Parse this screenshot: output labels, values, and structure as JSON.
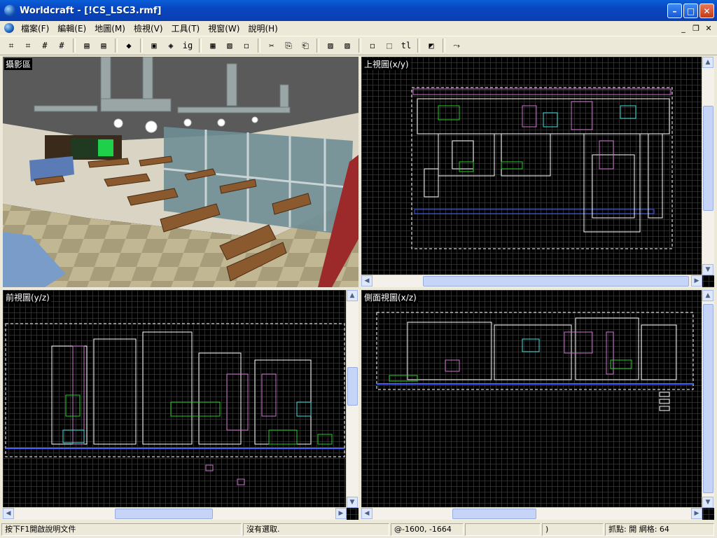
{
  "window": {
    "title": "Worldcraft - [!CS_LSC3.rmf]",
    "minimize": "–",
    "maximize": "□",
    "close": "✕"
  },
  "menu": {
    "items": [
      "檔案(F)",
      "編輯(E)",
      "地圖(M)",
      "檢視(V)",
      "工具(T)",
      "視窗(W)",
      "說明(H)"
    ],
    "mdi_minimize": "_",
    "mdi_restore": "❐",
    "mdi_close": "✕"
  },
  "toolbar": {
    "buttons": [
      "⌗",
      "⌗",
      "#",
      "#",
      "▤",
      "▤",
      "◆",
      "▣",
      "◈",
      "ig",
      "▦",
      "▧",
      "◻",
      "✂",
      "⎘",
      "⎗",
      "▨",
      "▨",
      "◻",
      "⬚",
      "tl",
      "◩",
      "⤳"
    ]
  },
  "panes": {
    "camera": {
      "label": "攝影區"
    },
    "top": {
      "label": "上視圖(x/y)"
    },
    "front": {
      "label": "前視圖(y/z)"
    },
    "side": {
      "label": "側面視圖(x/z)"
    }
  },
  "status": {
    "help": "按下F1開啟說明文件",
    "selection": "沒有選取.",
    "coords": "@-1600, -1664",
    "size": "",
    "paren": ")",
    "snap": "抓點: 開 網格: 64"
  },
  "colors": {
    "titlebar": "#0847c1",
    "chrome": "#ece9d8",
    "viewport_bg": "#000000",
    "grid": "#2c2c2c",
    "brush_white": "#ffffff",
    "brush_magenta": "#d070d0",
    "brush_green": "#20d020",
    "brush_cyan": "#40e0e0",
    "brush_blue": "#4060ff"
  }
}
